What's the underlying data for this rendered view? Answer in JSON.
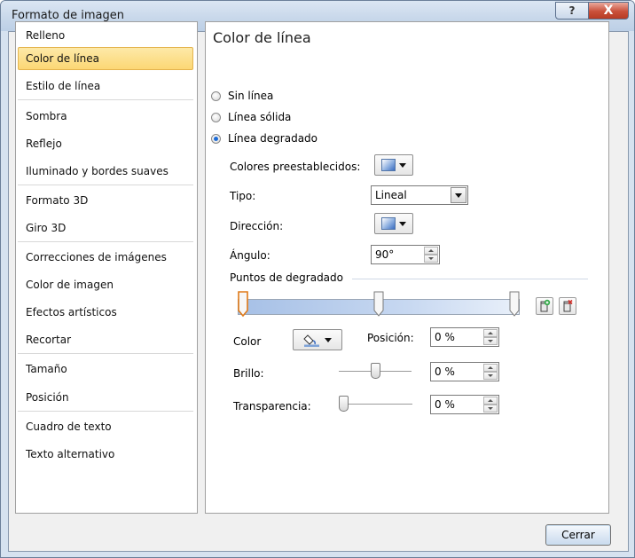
{
  "window": {
    "title": "Formato de imagen",
    "help_glyph": "?",
    "close_glyph": "X"
  },
  "sidebar": {
    "items": [
      {
        "label": "Relleno"
      },
      {
        "label": "Color de línea",
        "selected": true
      },
      {
        "label": "Estilo de línea"
      },
      {
        "label": "Sombra"
      },
      {
        "label": "Reflejo"
      },
      {
        "label": "Iluminado y bordes suaves"
      },
      {
        "label": "Formato 3D"
      },
      {
        "label": "Giro 3D"
      },
      {
        "label": "Correcciones de imágenes"
      },
      {
        "label": "Color de imagen"
      },
      {
        "label": "Efectos artísticos"
      },
      {
        "label": "Recortar"
      },
      {
        "label": "Tamaño"
      },
      {
        "label": "Posición"
      },
      {
        "label": "Cuadro de texto"
      },
      {
        "label": "Texto alternativo"
      }
    ]
  },
  "panel": {
    "title": "Color de línea",
    "radios": [
      {
        "label": "Sin línea",
        "checked": false
      },
      {
        "label": "Línea sólida",
        "checked": false
      },
      {
        "label": "Línea degradado",
        "checked": true
      }
    ],
    "preset_colors_label": "Colores preestablecidos:",
    "type_label": "Tipo:",
    "type_value": "Lineal",
    "direction_label": "Dirección:",
    "angle_label": "Ángulo:",
    "angle_value": "90°",
    "gradient_stops_label": "Puntos de degradado",
    "gradient_stop_positions": [
      0,
      50,
      100
    ],
    "color_label": "Color",
    "position_label": "Posición:",
    "position_value": "0 %",
    "brightness_label": "Brillo:",
    "brightness_value": "0 %",
    "brightness_level": 0,
    "transparency_label": "Transparencia:",
    "transparency_value": "0 %",
    "transparency_level": 0
  },
  "footer": {
    "close_label": "Cerrar"
  },
  "colors": {
    "selected_bg": "#fcd774",
    "accent": "#1d6bd6",
    "title_bar": "#c7d7ea"
  }
}
